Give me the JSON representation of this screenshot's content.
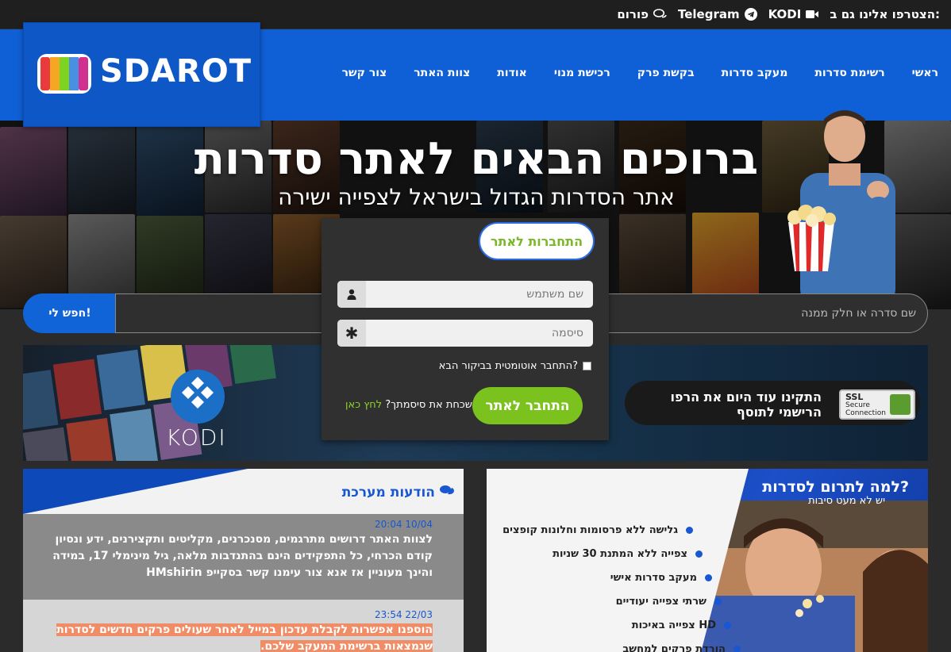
{
  "topbar": {
    "join_label": "הצטרפו אלינו גם ב:",
    "kodi_label": "KODI",
    "telegram_label": "Telegram",
    "forum_label": "פורום"
  },
  "logo": {
    "text": "SDAROT"
  },
  "nav": {
    "items": [
      "ראשי",
      "רשימת סדרות",
      "מעקב סדרות",
      "בקשת פרק",
      "רכישת מנוי",
      "אודות",
      "צוות האתר",
      "צור קשר"
    ]
  },
  "hero": {
    "title": "ברוכים הבאים לאתר סדרות",
    "subtitle": "אתר הסדרות הגדול בישראל לצפייה ישירה"
  },
  "search": {
    "button_label": "חפש לי!",
    "placeholder": "שם סדרה או חלק ממנה"
  },
  "banner": {
    "kodi_text": "KODI",
    "promo_text": "התקינו עוד היום את הרפו הרישמי לתוסף",
    "ssl_line1": "SSL",
    "ssl_line2": "Secure",
    "ssl_line3": "Connection"
  },
  "login": {
    "tab_label": "התחברות לאתר",
    "username_placeholder": "שם משתמש",
    "password_placeholder": "סיסמה",
    "remember_label": "התחבר אוטומטית בביקור הבא?",
    "login_button": "התחבר לאתר",
    "forgot_text": "שכחת את סיסמתך?",
    "forgot_link": "לחץ כאן"
  },
  "messages": {
    "title": "הודעות מערכת",
    "items": [
      {
        "date": "20:04 10/04",
        "text": "לצוות האתר דרושים מתרגמים, מסנכרנים, מקליטים ותקצירנים, ידע ונסיון קודם הכרחי, כל התפקידים הינם בהתנדבות מלאה, גיל מינימלי 17, במידה והינך מעוניין אז אנא צור עימנו קשר בסקייפ HMshirin"
      },
      {
        "date": "23:54 22/03",
        "text": "הוספנו אפשרות לקבלת עדכון במייל לאחר שעולים פרקים חדשים לסדרות שנמצאות ברשימת המעקב שלכם."
      }
    ]
  },
  "donate": {
    "title": "למה לתרום לסדרות?",
    "subtitle": "יש לא מעט סיבות",
    "items": [
      "גלישה ללא פרסומות וחלונות קופצים",
      "צפייה ללא המתנת 30 שניות",
      "מעקב סדרות אישי",
      "שרתי צפייה יעודיים",
      "צפייה באיכות HD",
      "הורדת פרקים למחשב"
    ]
  },
  "colors": {
    "brand_blue": "#0f5fd6",
    "accent_green": "#7cc21f",
    "highlight": "#f08d66"
  }
}
